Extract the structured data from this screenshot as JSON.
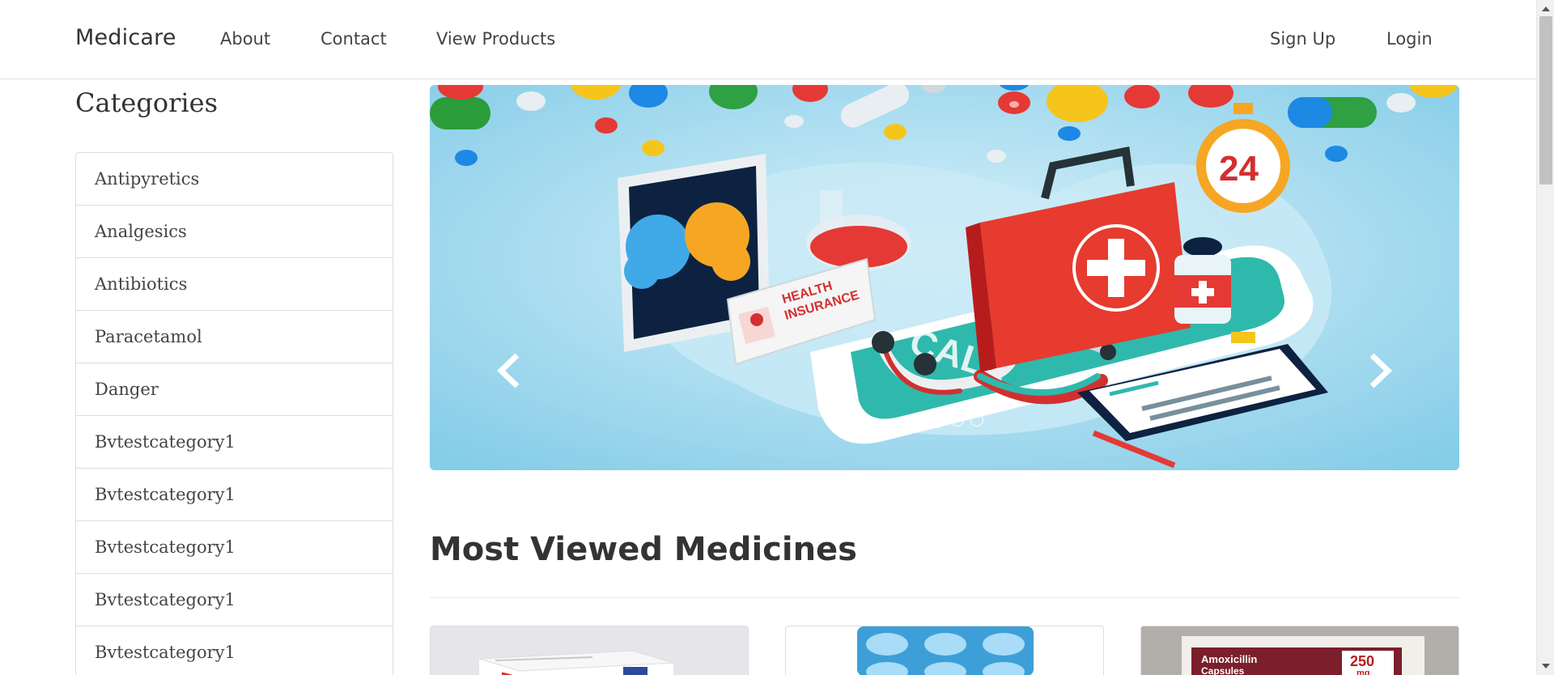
{
  "navbar": {
    "brand": "Medicare",
    "links": [
      "About",
      "Contact",
      "View Products"
    ],
    "right_links": [
      "Sign Up",
      "Login"
    ]
  },
  "categories": {
    "heading": "Categories",
    "items": [
      "Antipyretics",
      "Analgesics",
      "Antibiotics",
      "Paracetamol",
      "Danger",
      "Bvtestcategory1",
      "Bvtestcategory1",
      "Bvtestcategory1",
      "Bvtestcategory1",
      "Bvtestcategory1"
    ]
  },
  "carousel": {
    "slides": 4,
    "active_slide": 2,
    "prev_icon": "chevron-left-icon",
    "next_icon": "chevron-right-icon",
    "image_text": {
      "badge_line1": "HEALTH",
      "badge_line2": "INSURANCE",
      "clock_number": "24",
      "phone_text": "CALL"
    }
  },
  "most_viewed": {
    "heading": "Most Viewed Medicines",
    "products": [
      {
        "image": "medicine-box"
      },
      {
        "image": "blue-tablet-blister"
      },
      {
        "image": "amoxicillin-box",
        "text_line1": "Amoxicillin",
        "text_line2": "Capsules",
        "dose": "250",
        "unit": "mg"
      }
    ]
  },
  "colors": {
    "accent_red": "#e63b2e",
    "sky": "#a9dcef",
    "teal": "#2fb9ad"
  }
}
